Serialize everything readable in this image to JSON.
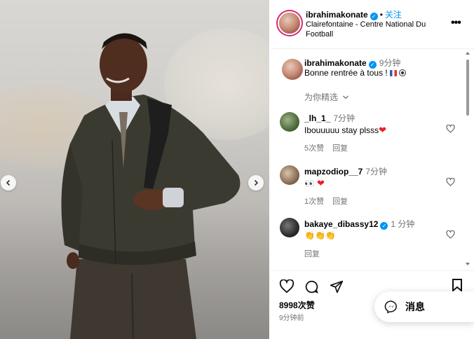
{
  "post": {
    "username": "ibrahimakonate",
    "follow_label": "关注",
    "location": "Clairefontaine - Centre National Du Football",
    "caption_user": "ibrahimakonate",
    "caption_time": "9分钟",
    "caption_text": "Bonne rentrée à tous !",
    "filter_label": "为你精选",
    "likes": "8998次赞",
    "posted_ago": "9分钟前"
  },
  "comments": [
    {
      "user": "_lh_1_",
      "time": "7分钟",
      "text": "Ibouuuuu stay plsss",
      "likes": "5次赞",
      "reply": "回复",
      "avatar_color": "#4f6b3a"
    },
    {
      "user": "mapzodiop__7",
      "time": "7分钟",
      "text": "",
      "likes": "1次赞",
      "reply": "回复",
      "avatar_color": "#8a6d55"
    },
    {
      "user": "bakaye_dibassy12",
      "time": "1 分钟",
      "text": "",
      "likes": "",
      "reply": "回复",
      "avatar_color": "#2b2b2b"
    }
  ],
  "messages": {
    "label": "消息"
  },
  "icons": [
    "chevron-left-icon",
    "chevron-right-icon",
    "verified-icon",
    "more-icon",
    "chevron-down-icon",
    "heart-icon",
    "comment-icon",
    "share-icon",
    "bookmark-icon",
    "messenger-icon"
  ],
  "colors": {
    "accent": "#0095f6",
    "heart": "#ed1c24",
    "muted": "#737373"
  }
}
